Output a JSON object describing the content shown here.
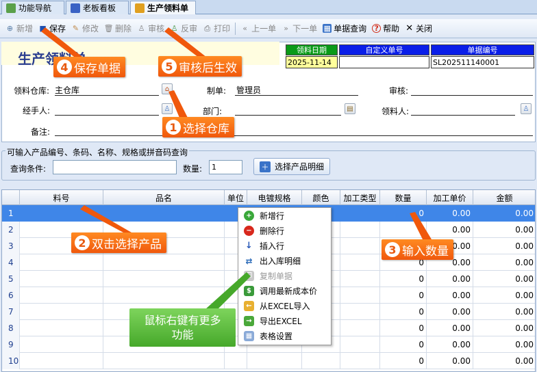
{
  "tabs": [
    {
      "label": "功能导航",
      "icon": "navigation-icon",
      "active": false
    },
    {
      "label": "老板看板",
      "icon": "dashboard-icon",
      "active": false
    },
    {
      "label": "生产领料单",
      "icon": "material-requisition-icon",
      "active": true
    }
  ],
  "toolbar": [
    {
      "label": "新增",
      "icon": "add-icon",
      "enabled": false
    },
    {
      "label": "保存",
      "icon": "save-icon",
      "enabled": true
    },
    {
      "label": "修改",
      "icon": "edit-icon",
      "enabled": false
    },
    {
      "label": "删除",
      "icon": "delete-icon",
      "enabled": false
    },
    {
      "label": "审核",
      "icon": "approve-icon",
      "enabled": false
    },
    {
      "label": "反审",
      "icon": "unapprove-icon",
      "enabled": false
    },
    {
      "label": "打印",
      "icon": "print-icon",
      "enabled": false
    },
    {
      "label": "上一单",
      "icon": "previous-icon",
      "enabled": false
    },
    {
      "label": "下一单",
      "icon": "next-icon",
      "enabled": false
    },
    {
      "label": "单据查询",
      "icon": "query-icon",
      "enabled": true
    },
    {
      "label": "帮助",
      "icon": "help-icon",
      "enabled": true
    },
    {
      "label": "关闭",
      "icon": "close-icon",
      "enabled": true
    }
  ],
  "form": {
    "title": "生产领料单",
    "header_fields": [
      {
        "label": "领料日期",
        "value": "2025-11-14"
      },
      {
        "label": "自定义单号",
        "value": ""
      },
      {
        "label": "单据编号",
        "value": "SL202511140001"
      }
    ],
    "warehouse_label": "领料仓库:",
    "warehouse_value": "主仓库",
    "maker_label": "制单:",
    "maker_value": "管理员",
    "reviewer_label": "审核:",
    "reviewer_value": "",
    "handler_label": "经手人:",
    "handler_value": "",
    "department_label": "部门:",
    "department_value": "",
    "receiver_label": "领料人:",
    "receiver_value": "",
    "remark_label": "备注:",
    "remark_value": ""
  },
  "query": {
    "group_title": "可输入产品编号、条码、名称、规格或拼音码查询",
    "condition_label": "查询条件:",
    "condition_value": "",
    "qty_label": "数量:",
    "qty_value": "1",
    "select_button": "选择产品明细"
  },
  "grid": {
    "columns": [
      "",
      "料号",
      "品名",
      "单位",
      "电镀规格",
      "颜色",
      "加工类型",
      "数量",
      "加工单价",
      "金额"
    ],
    "rows": [
      {
        "no": "1",
        "qty": "0",
        "price": "0.00",
        "amount": "0.00"
      },
      {
        "no": "2",
        "qty": "0",
        "price": "0.00",
        "amount": "0.00"
      },
      {
        "no": "3",
        "qty": "0",
        "price": "0.00",
        "amount": "0.00"
      },
      {
        "no": "4",
        "qty": "0",
        "price": "0.00",
        "amount": "0.00"
      },
      {
        "no": "5",
        "qty": "0",
        "price": "0.00",
        "amount": "0.00"
      },
      {
        "no": "6",
        "qty": "0",
        "price": "0.00",
        "amount": "0.00"
      },
      {
        "no": "7",
        "qty": "0",
        "price": "0.00",
        "amount": "0.00"
      },
      {
        "no": "8",
        "qty": "0",
        "price": "0.00",
        "amount": "0.00"
      },
      {
        "no": "9",
        "qty": "0",
        "price": "0.00",
        "amount": "0.00"
      },
      {
        "no": "10",
        "qty": "0",
        "price": "0.00",
        "amount": "0.00"
      }
    ]
  },
  "context_menu": [
    {
      "label": "新增行",
      "icon": "add-row-icon",
      "enabled": true
    },
    {
      "label": "删除行",
      "icon": "delete-row-icon",
      "enabled": true
    },
    {
      "label": "插入行",
      "icon": "insert-row-icon",
      "enabled": true
    },
    {
      "label": "出入库明细",
      "icon": "stock-detail-icon",
      "enabled": true
    },
    {
      "label": "复制单据",
      "icon": "copy-document-icon",
      "enabled": false
    },
    {
      "label": "调用最新成本价",
      "icon": "latest-cost-icon",
      "enabled": true
    },
    {
      "label": "从EXCEL导入",
      "icon": "excel-import-icon",
      "enabled": true
    },
    {
      "label": "导出EXCEL",
      "icon": "excel-export-icon",
      "enabled": true
    },
    {
      "label": "表格设置",
      "icon": "table-settings-icon",
      "enabled": true
    }
  ],
  "callouts": {
    "c1": {
      "num": "1",
      "text": "选择仓库"
    },
    "c2": {
      "num": "2",
      "text": "双击选择产品"
    },
    "c3": {
      "num": "3",
      "text": "输入数量"
    },
    "c4": {
      "num": "4",
      "text": "保存单据"
    },
    "c5": {
      "num": "5",
      "text": "审核后生效"
    },
    "green": "鼠标右键有更多\n功能"
  },
  "colors": {
    "accent": "#3f86e8",
    "callout": "#f0580c",
    "callout_green": "#46a82a",
    "title": "#2a3d8f"
  }
}
